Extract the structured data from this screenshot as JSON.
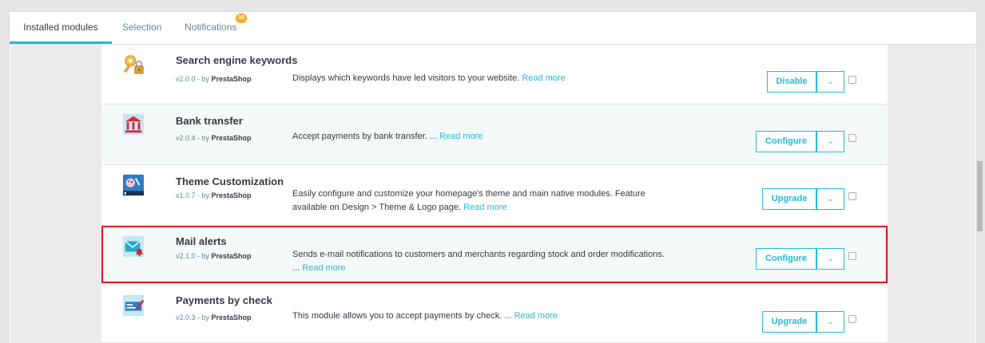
{
  "tabs": [
    {
      "label": "Installed modules",
      "active": true
    },
    {
      "label": "Selection",
      "active": false
    },
    {
      "label": "Notifications",
      "active": false,
      "badge": "10"
    }
  ],
  "modules": [
    {
      "name": "Search engine keywords",
      "version": "v2.0.0 - by ",
      "author": "PrestaShop",
      "description": "Displays which keywords have led visitors to your website. ",
      "read_more": "Read more",
      "action": "Disable",
      "icon": "keys-lock-icon"
    },
    {
      "name": "Bank transfer",
      "version": "v2.0.4 - by ",
      "author": "PrestaShop",
      "description": "Accept payments by bank transfer. ... ",
      "read_more": "Read more",
      "action": "Configure",
      "icon": "bank-icon"
    },
    {
      "name": "Theme Customization",
      "version": "v1.0.7 - by ",
      "author": "PrestaShop",
      "description": "Easily configure and customize your homepage's theme and main native modules. Feature available on Design > Theme & Logo page. ",
      "read_more": "Read more",
      "action": "Upgrade",
      "icon": "theme-customization-icon"
    },
    {
      "name": "Mail alerts",
      "version": "v2.1.0 - by ",
      "author": "PrestaShop",
      "description": "Sends e-mail notifications to customers and merchants regarding stock and order modifications. ... ",
      "read_more": "Read more",
      "action": "Configure",
      "icon": "mail-alert-icon"
    },
    {
      "name": "Payments by check",
      "version": "v2.0.3 - by ",
      "author": "PrestaShop",
      "description": "This module allows you to accept payments by check. ... ",
      "read_more": "Read more",
      "action": "Upgrade",
      "icon": "check-payment-icon"
    }
  ],
  "dropdown_glyph": "⌄",
  "colors": {
    "accent": "#25b9d7",
    "highlight": "#e8101f",
    "badge": "#f9a825"
  }
}
